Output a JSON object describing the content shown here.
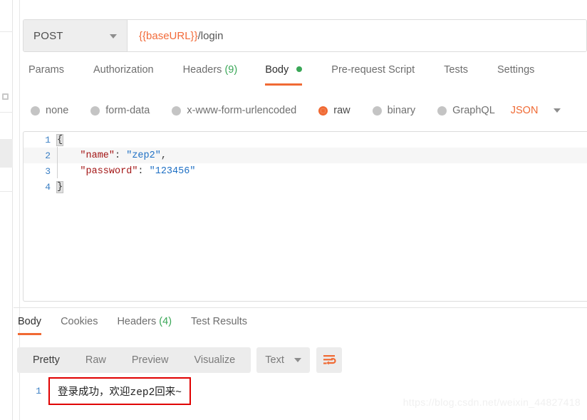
{
  "sidebar": {
    "icon": "settings-icon"
  },
  "request": {
    "method": "POST",
    "method_caret": "chevron-down-icon",
    "url_variable": "{{baseURL}}",
    "url_path": "/login",
    "tabs": [
      {
        "label": "Params",
        "active": false,
        "count": "",
        "dot": false
      },
      {
        "label": "Authorization",
        "active": false,
        "count": "",
        "dot": false
      },
      {
        "label": "Headers",
        "active": false,
        "count": "(9)",
        "dot": false
      },
      {
        "label": "Body",
        "active": true,
        "count": "",
        "dot": true
      },
      {
        "label": "Pre-request Script",
        "active": false,
        "count": "",
        "dot": false
      },
      {
        "label": "Tests",
        "active": false,
        "count": "",
        "dot": false
      },
      {
        "label": "Settings",
        "active": false,
        "count": "",
        "dot": false
      }
    ],
    "body_types": [
      {
        "label": "none",
        "selected": false
      },
      {
        "label": "form-data",
        "selected": false
      },
      {
        "label": "x-www-form-urlencoded",
        "selected": false
      },
      {
        "label": "raw",
        "selected": true
      },
      {
        "label": "binary",
        "selected": false
      },
      {
        "label": "GraphQL",
        "selected": false
      }
    ],
    "format_label": "JSON",
    "format_caret": "chevron-down-icon",
    "code_lines": [
      {
        "num": "1",
        "indent": "",
        "open_brace": "{",
        "key": "",
        "colon": "",
        "value": "",
        "comma": "",
        "close_brace": ""
      },
      {
        "num": "2",
        "indent": "    ",
        "open_brace": "",
        "key": "\"name\"",
        "colon": ": ",
        "value": "\"zep2\"",
        "comma": ",",
        "close_brace": ""
      },
      {
        "num": "3",
        "indent": "    ",
        "open_brace": "",
        "key": "\"password\"",
        "colon": ": ",
        "value": "\"123456\"",
        "comma": "",
        "close_brace": ""
      },
      {
        "num": "4",
        "indent": "",
        "open_brace": "",
        "key": "",
        "colon": "",
        "value": "",
        "comma": "",
        "close_brace": "}"
      }
    ]
  },
  "response": {
    "tabs": [
      {
        "label": "Body",
        "active": true,
        "count": ""
      },
      {
        "label": "Cookies",
        "active": false,
        "count": ""
      },
      {
        "label": "Headers",
        "active": false,
        "count": "(4)"
      },
      {
        "label": "Test Results",
        "active": false,
        "count": ""
      }
    ],
    "format_buttons": [
      {
        "label": "Pretty",
        "active": true
      },
      {
        "label": "Raw",
        "active": false
      },
      {
        "label": "Preview",
        "active": false
      },
      {
        "label": "Visualize",
        "active": false
      }
    ],
    "content_type": "Text",
    "content_type_caret": "chevron-down-icon",
    "wrap_icon": "word-wrap-icon",
    "body_line_number": "1",
    "body_text": "登录成功，欢迎zep2回来~"
  },
  "watermark": "https://blog.csdn.net/weixin_44827418",
  "colors": {
    "accent": "#f06a34",
    "green": "#3aa757",
    "highlight_red": "#e00000",
    "json_key": "#a31515",
    "json_string": "#1d6fc4",
    "line_number": "#3b7fc4"
  }
}
